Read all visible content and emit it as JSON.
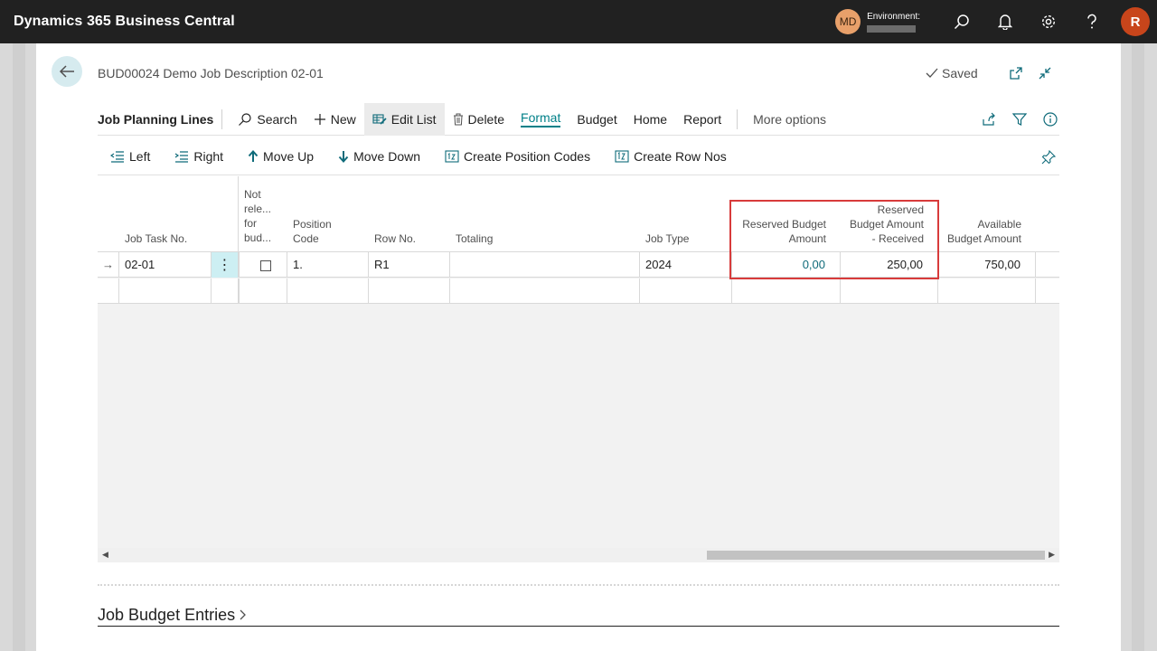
{
  "app": {
    "title": "Dynamics 365 Business Central",
    "user_initials": "MD",
    "environment_label": "Environment:",
    "profile_initial": "R"
  },
  "page": {
    "title": "BUD00024 Demo Job Description 02-01",
    "status": "Saved"
  },
  "actionbar": {
    "caption": "Job Planning Lines",
    "search": "Search",
    "new": "New",
    "edit_list": "Edit List",
    "delete": "Delete",
    "format": "Format",
    "budget": "Budget",
    "home": "Home",
    "report": "Report",
    "more": "More options"
  },
  "toolbar": {
    "left": "Left",
    "right": "Right",
    "move_up": "Move Up",
    "move_down": "Move Down",
    "create_position_codes": "Create Position Codes",
    "create_row_nos": "Create Row Nos"
  },
  "columns": {
    "job_task_no": "Job Task No.",
    "not_released_1": "Not",
    "not_released_2": "rele...",
    "not_released_3": "for",
    "not_released_4": "bud...",
    "position_code_1": "Position",
    "position_code_2": "Code",
    "row_no": "Row No.",
    "totaling": "Totaling",
    "job_type": "Job Type",
    "reserved_1": "Reserved Budget",
    "reserved_2": "Amount",
    "received_1": "Reserved",
    "received_2": "Budget Amount",
    "received_3": "- Received",
    "available_1": "Available",
    "available_2": "Budget Amount"
  },
  "rows": [
    {
      "job_task_no": "02-01",
      "not_released": false,
      "position_code": "1.",
      "row_no": "R1",
      "totaling": "",
      "job_type": "2024",
      "reserved_budget_amount": "0,00",
      "reserved_received": "250,00",
      "available_budget_amount": "750,00"
    }
  ],
  "section": {
    "title": "Job Budget Entries"
  },
  "colors": {
    "accent": "#008088",
    "highlight": "#d83b3b",
    "appbar": "#212121"
  }
}
